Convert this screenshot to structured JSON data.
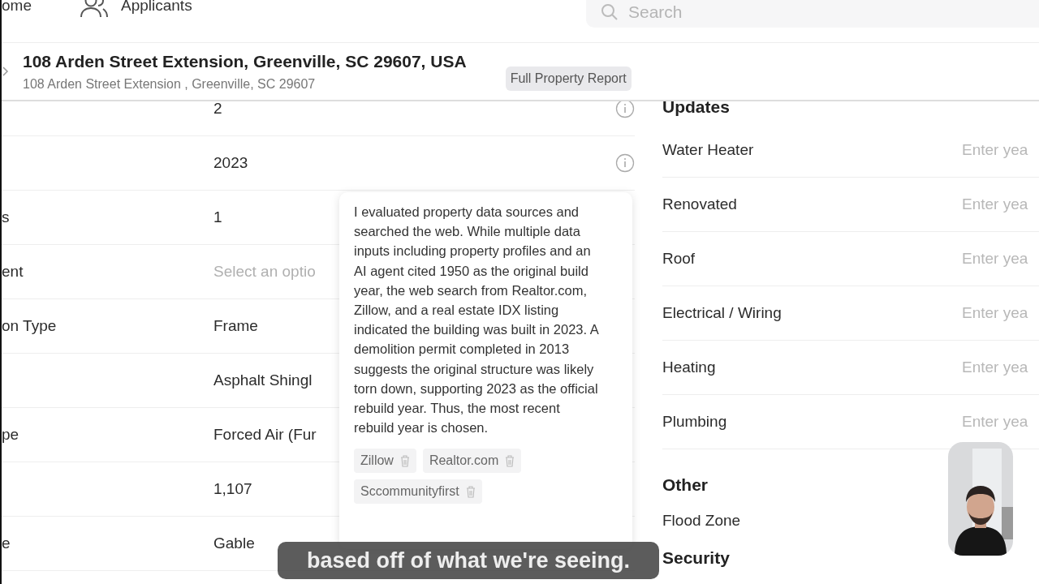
{
  "nav": {
    "items": [
      {
        "label": "ome",
        "kind": "text"
      },
      {
        "label": "Applicants",
        "kind": "people"
      }
    ],
    "search": {
      "placeholder": "Search"
    }
  },
  "header": {
    "title": "108 Arden Street Extension, Greenville, SC 29607, USA",
    "subtitle": "108 Arden Street Extension , Greenville, SC 29607",
    "badge": "Full Property Report"
  },
  "details": [
    {
      "value": "2",
      "info": true
    },
    {
      "value": "2023",
      "info": true
    },
    {
      "label": "s",
      "value": "1",
      "info": false
    },
    {
      "label": "ent",
      "placeholder": "Select an optio",
      "info": false
    },
    {
      "label": "on Type",
      "value": "Frame",
      "info": false
    },
    {
      "value": "Asphalt Shingl",
      "info": false
    },
    {
      "label": "pe",
      "value": "Forced Air (Fur",
      "info": false
    },
    {
      "value": "1,107",
      "info": false
    },
    {
      "label": "e",
      "value": "Gable",
      "info": false
    }
  ],
  "popover": {
    "text": "I evaluated property data sources and searched the web. While multiple data inputs including property profiles and an AI agent cited 1950 as the original build year, the web search from Realtor.com, Zillow, and a real estate IDX listing indicated the building was built in 2023. A demolition permit completed in 2013 suggests the original structure was likely torn down, supporting 2023 as the official rebuild year. Thus, the most recent rebuild year is chosen.",
    "sources": [
      "Zillow",
      "Realtor.com",
      "Sccommunityfirst"
    ]
  },
  "updates": {
    "title": "Updates",
    "rows": [
      {
        "label": "Water Heater",
        "placeholder": "Enter yea"
      },
      {
        "label": "Renovated",
        "placeholder": "Enter yea"
      },
      {
        "label": "Roof",
        "placeholder": "Enter yea"
      },
      {
        "label": "Electrical / Wiring",
        "placeholder": "Enter yea"
      },
      {
        "label": "Heating",
        "placeholder": "Enter yea"
      },
      {
        "label": "Plumbing",
        "placeholder": "Enter yea"
      }
    ]
  },
  "other": {
    "title": "Other",
    "rows": [
      {
        "label": "Flood Zone"
      }
    ]
  },
  "security": {
    "title": "Security"
  },
  "caption": "based off of what we're seeing."
}
